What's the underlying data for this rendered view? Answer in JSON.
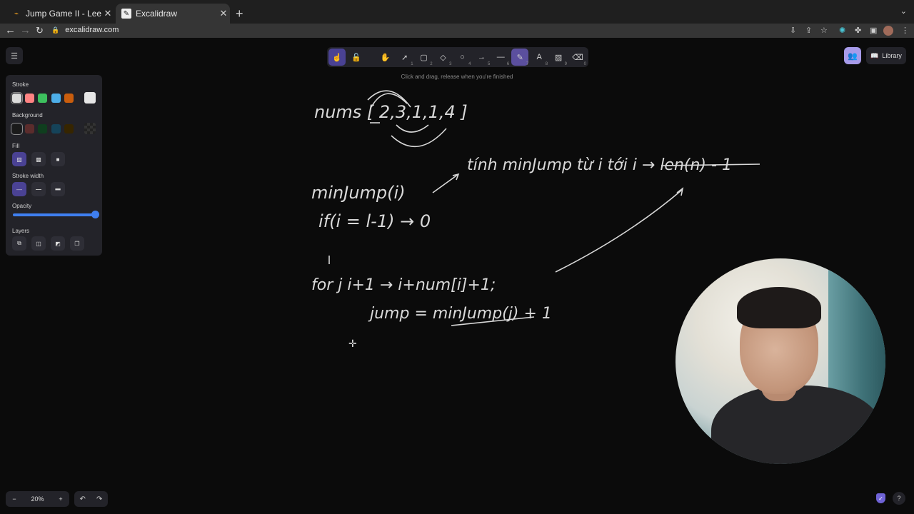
{
  "browser": {
    "tabs": [
      {
        "title": "Jump Game II - LeetCode",
        "favicon": "leetcode-icon",
        "active": false
      },
      {
        "title": "Excalidraw",
        "favicon": "excalidraw-icon",
        "active": true
      }
    ],
    "url": "excalidraw.com"
  },
  "toolbar": {
    "selected_tool": "freedraw",
    "tools": [
      {
        "name": "lock",
        "key": ""
      },
      {
        "name": "hand",
        "key": ""
      },
      {
        "name": "selection",
        "key": "1"
      },
      {
        "name": "rectangle",
        "key": "2"
      },
      {
        "name": "diamond",
        "key": "3"
      },
      {
        "name": "ellipse",
        "key": "4"
      },
      {
        "name": "arrow",
        "key": "5"
      },
      {
        "name": "line",
        "key": "6"
      },
      {
        "name": "freedraw",
        "key": "7"
      },
      {
        "name": "text",
        "key": "8"
      },
      {
        "name": "image",
        "key": "9"
      },
      {
        "name": "eraser",
        "key": "0"
      }
    ],
    "hint": "Click and drag, release when you're finished"
  },
  "library_label": "Library",
  "panel": {
    "stroke_label": "Stroke",
    "background_label": "Background",
    "fill_label": "Fill",
    "stroke_width_label": "Stroke width",
    "opacity_label": "Opacity",
    "layers_label": "Layers",
    "stroke_colors": [
      "#dcdcdc",
      "#ff8383",
      "#3dc05e",
      "#4daee8",
      "#c95d0d"
    ],
    "stroke_current": "#e6e6e6",
    "background_colors": [
      "#1a1a1a",
      "#5b2c2c",
      "#0f3e1e",
      "#154359",
      "#362500"
    ],
    "opacity_value": 100
  },
  "zoom": {
    "minus": "−",
    "value": "20%",
    "plus": "+"
  },
  "drawing": {
    "line1": "nums [ 2,3,1,1,4 ]",
    "line2": "minJump(i)",
    "note": "tính minJump từ i tới i → len(n) - 1",
    "line3": "if(i = l-1) → 0",
    "line4": "for j   i+1 →  i+num[i]+1;",
    "line5": "jump =   minJump(j) + 1"
  }
}
